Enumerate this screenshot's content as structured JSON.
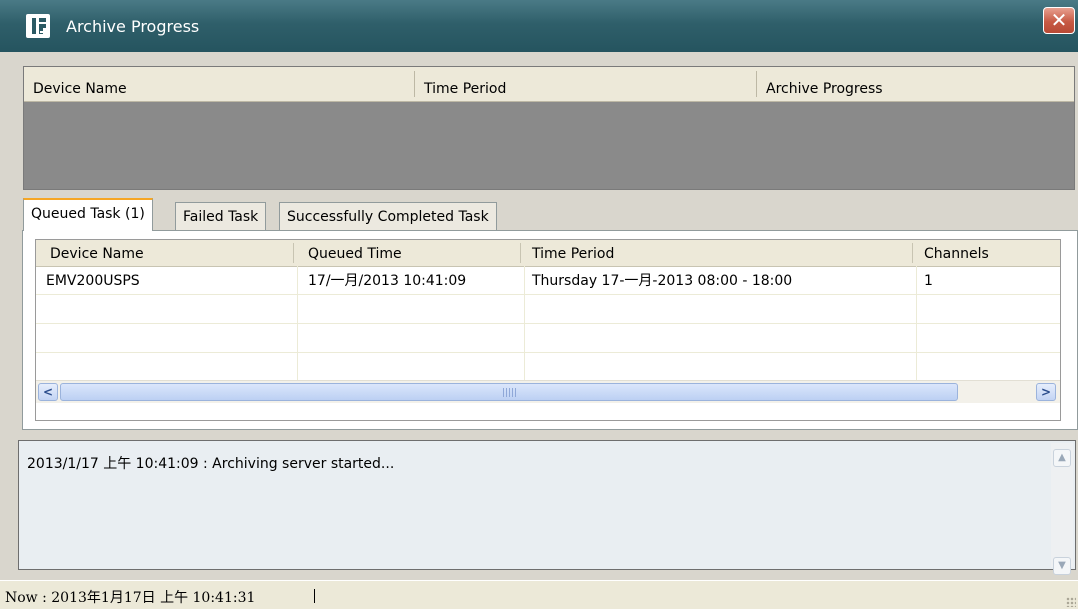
{
  "window": {
    "title": "Archive Progress",
    "close_symbol": "✕"
  },
  "progress_table": {
    "columns": [
      "Device Name",
      "Time Period",
      "Archive Progress"
    ]
  },
  "tabs": [
    {
      "label": "Queued Task (1)",
      "active": true
    },
    {
      "label": "Failed Task",
      "active": false
    },
    {
      "label": "Successfully Completed Task",
      "active": false
    }
  ],
  "queued_grid": {
    "columns": [
      "Device Name",
      "Queued Time",
      "Time Period",
      "Channels"
    ],
    "rows": [
      {
        "device": "EMV200USPS",
        "queued_time": "17/一月/2013 10:41:09",
        "time_period": "Thursday 17-一月-2013 08:00 - 18:00",
        "channels": "1"
      }
    ]
  },
  "log": {
    "lines": [
      "2013/1/17 上午 10:41:09 : Archiving server started..."
    ]
  },
  "status": {
    "text": "Now : 2013年1月17日 上午 10:41:31"
  },
  "colors": {
    "titlebar": "#2f5f6a",
    "close_button": "#c75a44",
    "active_tab_accent": "#f6a623"
  }
}
